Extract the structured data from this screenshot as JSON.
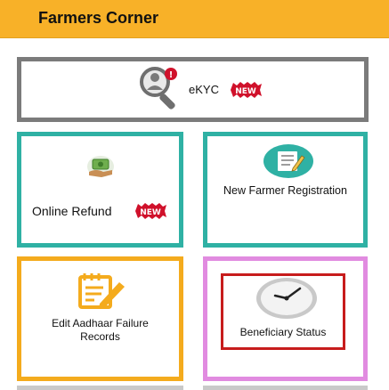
{
  "header": {
    "title": "Farmers Corner"
  },
  "tiles": {
    "ekyc": {
      "label": "eKYC",
      "badge": "NEW",
      "icon": "magnifier-user-icon"
    },
    "refund": {
      "label": "Online Refund",
      "badge": "NEW",
      "icon": "money-hand-icon"
    },
    "new_farmer": {
      "label": "New Farmer Registration",
      "icon": "registration-form-icon"
    },
    "aadhaar": {
      "label": "Edit Aadhaar Failure Records",
      "icon": "edit-document-icon"
    },
    "beneficiary": {
      "label": "Beneficiary Status",
      "icon": "clock-icon"
    }
  },
  "colors": {
    "header_bg": "#f8b128",
    "ekyc_border": "#7b7b7b",
    "teal_border": "#2fb1a4",
    "orange_border": "#f4ab1d",
    "pink_border": "#e18be0",
    "highlight_border": "#c71c1c",
    "badge_red": "#d0112b"
  }
}
